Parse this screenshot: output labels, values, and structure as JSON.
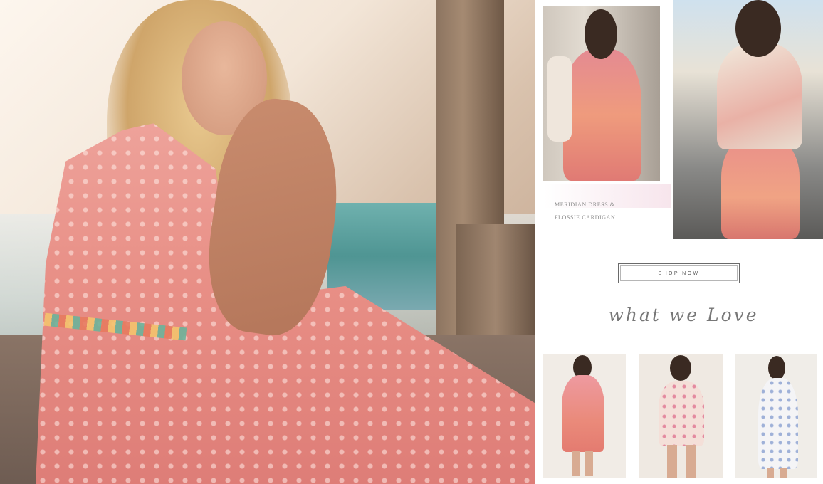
{
  "hero": {
    "image_alt": "Model in pink lace dress seated on a dock"
  },
  "editorial": {
    "caption_line1": "MERIDIAN DRESS &",
    "caption_line2": "FLOSSIE CARDIGAN"
  },
  "cta": {
    "shop_label": "SHOP NOW"
  },
  "section": {
    "heading": "what we Love"
  },
  "colors": {
    "dress_pink": "#e88f86",
    "button_border": "#6a6a6a",
    "text_gray": "#777777"
  }
}
